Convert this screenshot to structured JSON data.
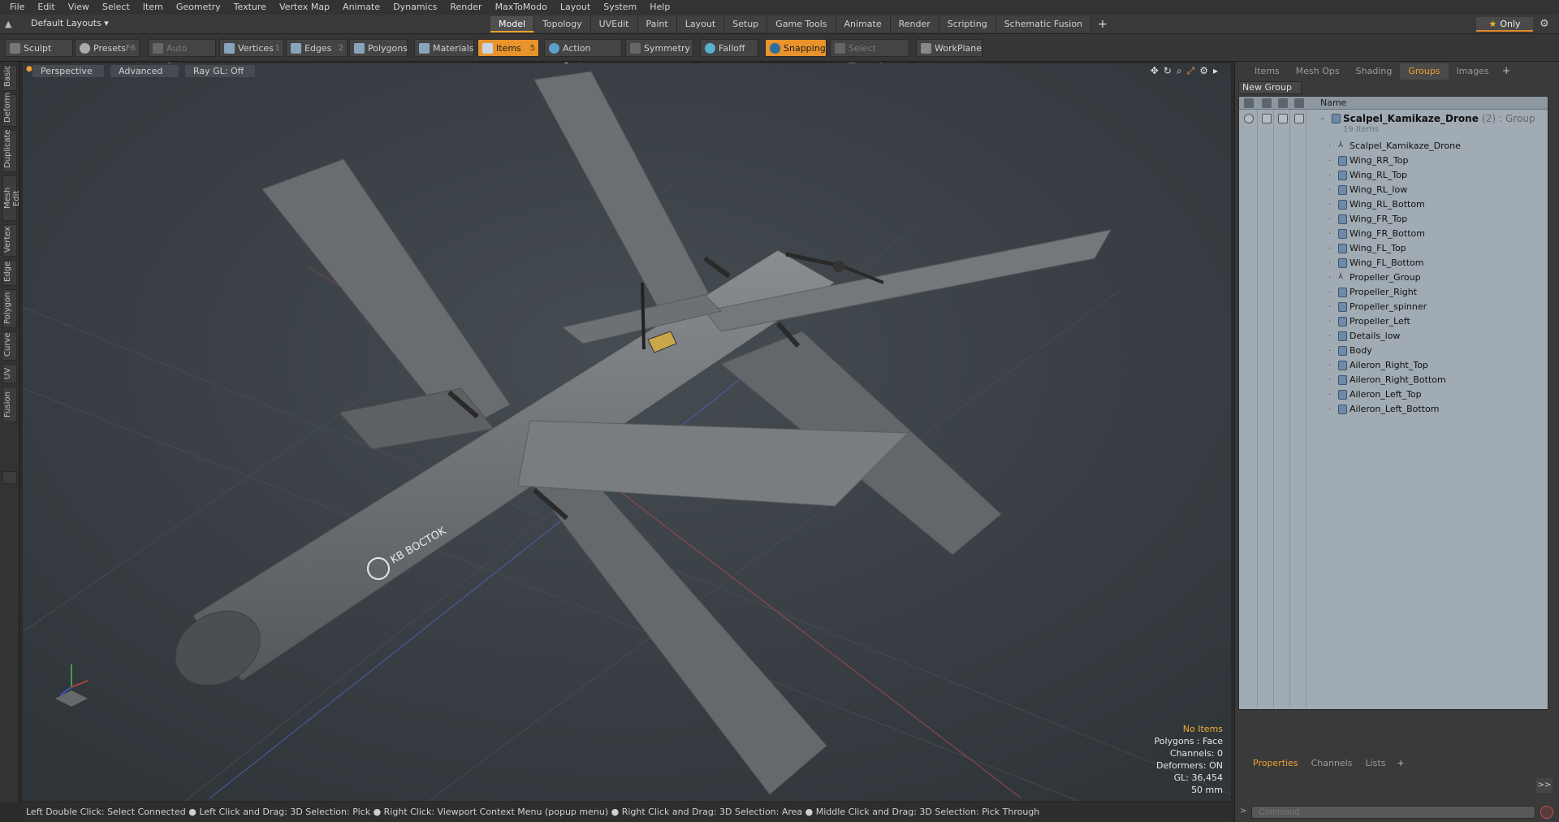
{
  "menu": [
    "File",
    "Edit",
    "View",
    "Select",
    "Item",
    "Geometry",
    "Texture",
    "Vertex Map",
    "Animate",
    "Dynamics",
    "Render",
    "MaxToModo",
    "Layout",
    "System",
    "Help"
  ],
  "layout_dropdown": "Default Layouts ▾",
  "mode_tabs": [
    "Model",
    "Topology",
    "UVEdit",
    "Paint",
    "Layout",
    "Setup",
    "Game Tools",
    "Animate",
    "Render",
    "Scripting",
    "Schematic Fusion"
  ],
  "mode_tab_active": "Model",
  "only_label": "Only",
  "toolbar": {
    "sculpt": "Sculpt",
    "presets": "Presets",
    "presets_key": "F6",
    "auto_select": "Auto Select",
    "vertices": "Vertices",
    "vertices_key": "1",
    "edges": "Edges",
    "edges_key": "2",
    "polygons": "Polygons",
    "materials": "Materials",
    "items": "Items",
    "items_key": "5",
    "action_center": "Action Center",
    "symmetry": "Symmetry",
    "falloff": "Falloff",
    "snapping": "Snapping",
    "select_through": "Select Through",
    "workplane": "WorkPlane"
  },
  "left_tabs": [
    "Basic",
    "Deform",
    "Duplicate",
    "Mesh Edit",
    "Vertex",
    "Edge",
    "Polygon",
    "Curve",
    "UV",
    "Fusion"
  ],
  "viewport": {
    "view": "Perspective",
    "shading": "Advanced",
    "raygl": "Ray GL: Off",
    "fuselage_text": "KB BOCTOK",
    "info": {
      "no_items": "No Items",
      "polygons": "Polygons : Face",
      "channels": "Channels: 0",
      "deformers": "Deformers: ON",
      "gl": "GL: 36,454",
      "scale": "50 mm"
    }
  },
  "statusbar": "Left Double Click: Select Connected ● Left Click and Drag: 3D Selection: Pick ● Right Click: Viewport Context Menu (popup menu) ● Right Click and Drag: 3D Selection: Area ● Middle Click and Drag: 3D Selection: Pick Through",
  "right_panel": {
    "tabs": [
      "Items",
      "Mesh Ops",
      "Shading",
      "Groups",
      "Images"
    ],
    "active_tab": "Groups",
    "new_group": "New Group",
    "column_name": "Name",
    "root": {
      "name": "Scalpel_Kamikaze_Drone",
      "count": "(2)",
      "type": ": Group",
      "subtitle": "19 Items"
    },
    "items": [
      {
        "name": "Scalpel_Kamikaze_Drone",
        "kind": "locator"
      },
      {
        "name": "Wing_RR_Top",
        "kind": "mesh"
      },
      {
        "name": "Wing_RL_Top",
        "kind": "mesh"
      },
      {
        "name": "Wing_RL_low",
        "kind": "mesh"
      },
      {
        "name": "Wing_RL_Bottom",
        "kind": "mesh"
      },
      {
        "name": "Wing_FR_Top",
        "kind": "mesh"
      },
      {
        "name": "Wing_FR_Bottom",
        "kind": "mesh"
      },
      {
        "name": "Wing_FL_Top",
        "kind": "mesh"
      },
      {
        "name": "Wing_FL_Bottom",
        "kind": "mesh"
      },
      {
        "name": "Propeller_Group",
        "kind": "locator"
      },
      {
        "name": "Propeller_Right",
        "kind": "mesh"
      },
      {
        "name": "Propeller_spinner",
        "kind": "mesh"
      },
      {
        "name": "Propeller_Left",
        "kind": "mesh"
      },
      {
        "name": "Details_low",
        "kind": "mesh"
      },
      {
        "name": "Body",
        "kind": "mesh"
      },
      {
        "name": "Aileron_Right_Top",
        "kind": "mesh"
      },
      {
        "name": "Aileron_Right_Bottom",
        "kind": "mesh"
      },
      {
        "name": "Aileron_Left_Top",
        "kind": "mesh"
      },
      {
        "name": "Aileron_Left_Bottom",
        "kind": "mesh"
      }
    ],
    "bottom_tabs": [
      "Properties",
      "Channels",
      "Lists"
    ],
    "bottom_active": "Properties",
    "command_placeholder": "Command"
  },
  "colors": {
    "accent": "#e8932c",
    "viewport_bg": "#3b4146",
    "tree_bg": "#a1abb4"
  }
}
